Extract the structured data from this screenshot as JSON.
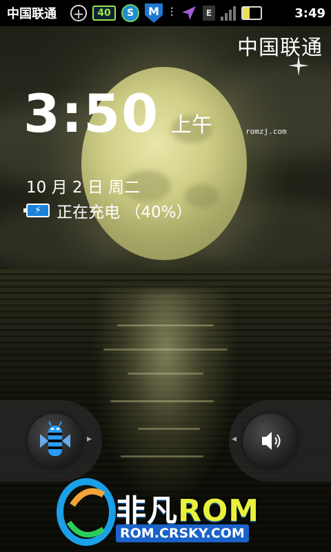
{
  "status_bar": {
    "carrier": "中国联通",
    "battery_box_text": "40",
    "shield_letter": "M",
    "edge_letter": "E",
    "time": "3:49",
    "battery_level_percent": 40,
    "icons": [
      "plus-circle-icon",
      "battery-percent-icon",
      "sogou-icon",
      "security-shield-icon",
      "usb-icon",
      "location-arrow-icon",
      "edge-network-icon",
      "signal-icon",
      "battery-charging-icon"
    ]
  },
  "lockscreen": {
    "carrier": "中国联通",
    "time": "3:50",
    "ampm": "上午",
    "watermark_small": "romzj.com",
    "date": "10 月 2 日 周二",
    "charging_text": "正在充电 （40%）",
    "charge_icon_glyph": "⚡",
    "unlock_tab_icon": "honeycomb-bugdroid-icon",
    "sound_tab_icon": "speaker-icon"
  },
  "watermark": {
    "brand_cn": "非凡",
    "brand_rom": "ROM",
    "url": "ROM.CRSKY.COM"
  }
}
